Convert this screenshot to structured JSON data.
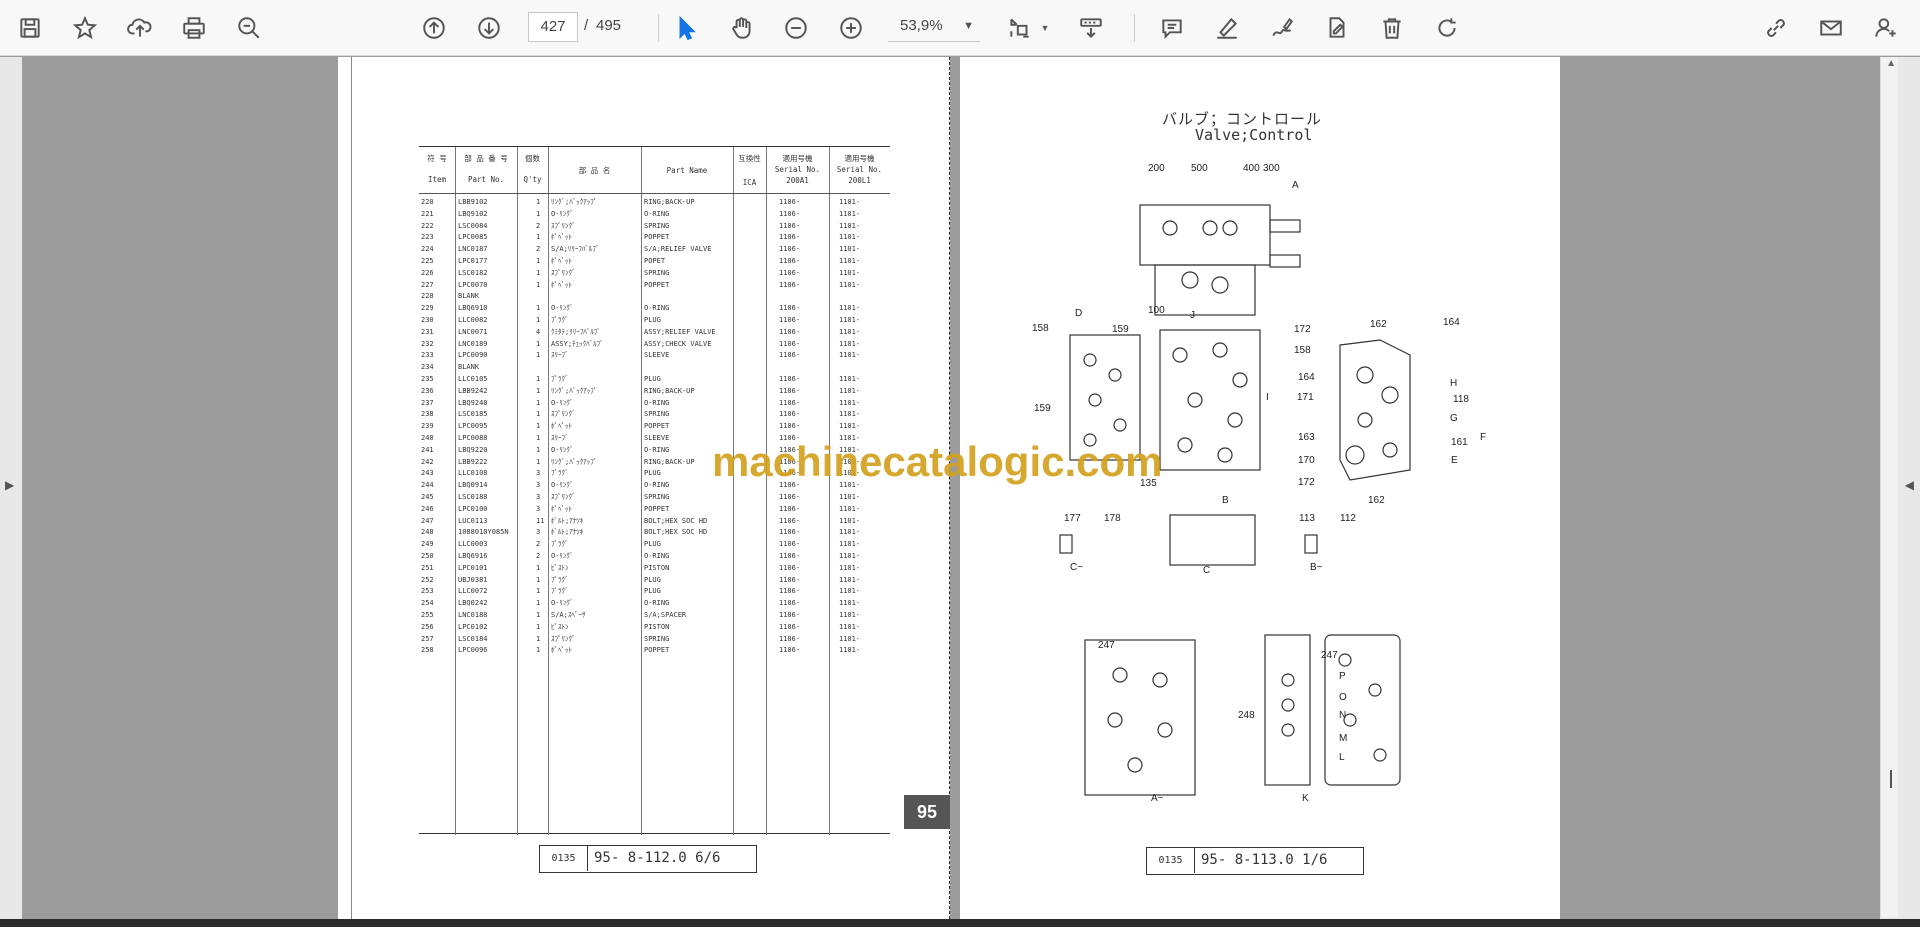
{
  "toolbar": {
    "page_current": "427",
    "page_separator": "/",
    "page_total": "495",
    "zoom_value": "53,9%",
    "icons": [
      "save-icon",
      "star-icon",
      "upload-icon",
      "print-icon",
      "zoom-search-icon",
      "page-up-icon",
      "page-down-icon",
      "select-cursor-icon",
      "hand-icon",
      "zoom-out-icon",
      "zoom-in-icon",
      "fit-page-icon",
      "scroll-mode-icon",
      "comment-icon",
      "highlight-icon",
      "sign-icon",
      "fill-sign-icon",
      "delete-icon",
      "rotate-icon",
      "share-link-icon",
      "email-icon",
      "add-user-icon"
    ]
  },
  "left_page": {
    "headers": {
      "item_jp": "符 号",
      "item_en": "Item",
      "part_no_jp": "部 品 番 号",
      "part_no_en": "Part No.",
      "qty_jp": "個数",
      "qty_en": "Q'ty",
      "name_jp": "部 品 名",
      "part_name": "Part Name",
      "ica_jp": "互換性",
      "ica": "ICA",
      "serial1_jp": "適用号機",
      "serial1_en": "Serial No.",
      "serial1_model": "200A1",
      "serial2_jp": "適用号機",
      "serial2_en": "Serial No.",
      "serial2_model": "200L1"
    },
    "rows": [
      [
        "220",
        "LBB9102",
        "1",
        "ﾘﾝｸﾞ;ﾊﾞｯｸｱｯﾌﾟ",
        "RING;BACK-UP",
        "1106-",
        "1101-"
      ],
      [
        "221",
        "LBQ9102",
        "1",
        "O-ﾘﾝｸﾞ",
        "O-RING",
        "1106-",
        "1101-"
      ],
      [
        "222",
        "LSC0084",
        "2",
        "ｽﾌﾟﾘﾝｸﾞ",
        "SPRING",
        "1106-",
        "1101-"
      ],
      [
        "223",
        "LPC0085",
        "1",
        "ﾎﾟﾍﾟｯﾄ",
        "POPPET",
        "1106-",
        "1101-"
      ],
      [
        "224",
        "LNC0187",
        "2",
        "S/A;ﾘﾘｰﾌﾊﾞﾙﾌﾞ",
        "S/A;RELIEF VALVE",
        "1106-",
        "1101-"
      ],
      [
        "225",
        "LPC0177",
        "1",
        "ﾎﾟﾍﾟｯﾄ",
        "POPET",
        "1106-",
        "1101-"
      ],
      [
        "226",
        "LSC0182",
        "1",
        "ｽﾌﾟﾘﾝｸﾞ",
        "SPRING",
        "1106-",
        "1101-"
      ],
      [
        "227",
        "LPC0070",
        "1",
        "ﾎﾟﾍﾟｯﾄ",
        "POPPET",
        "1106-",
        "1101-"
      ],
      [
        "228",
        "BLANK",
        "",
        "",
        "",
        "",
        ""
      ],
      [
        "229",
        "LBQ6910",
        "1",
        "O-ﾘﾝｸﾞ",
        "O-RING",
        "1106-",
        "1101-"
      ],
      [
        "230",
        "LLC0082",
        "1",
        "ﾌﾟﾗｸﾞ",
        "PLUG",
        "1106-",
        "1101-"
      ],
      [
        "231",
        "LNC0071",
        "4",
        "ｸﾐﾀﾃ;ﾘﾘｰﾌﾊﾞﾙﾌﾞ",
        "ASSY;RELIEF VALVE",
        "1106-",
        "1101-"
      ],
      [
        "232",
        "LNC0189",
        "1",
        "ASSY;ﾁｪｯｸﾊﾞﾙﾌﾞ",
        "ASSY;CHECK VALVE",
        "1106-",
        "1101-"
      ],
      [
        "233",
        "LPC0090",
        "1",
        "ｽﾘｰﾌﾞ",
        "SLEEVE",
        "1106-",
        "1101-"
      ],
      [
        "234",
        "BLANK",
        "",
        "",
        "",
        "",
        ""
      ],
      [
        "235",
        "LLC0105",
        "1",
        "ﾌﾟﾗｸﾞ",
        "PLUG",
        "1106-",
        "1101-"
      ],
      [
        "236",
        "LBB9242",
        "1",
        "ﾘﾝｸﾞ;ﾊﾞｯｸｱｯﾌﾟ",
        "RING;BACK-UP",
        "1106-",
        "1101-"
      ],
      [
        "237",
        "LBQ9240",
        "1",
        "O-ﾘﾝｸﾞ",
        "O-RING",
        "1106-",
        "1101-"
      ],
      [
        "238",
        "LSC0185",
        "1",
        "ｽﾌﾟﾘﾝｸﾞ",
        "SPRING",
        "1106-",
        "1101-"
      ],
      [
        "239",
        "LPC0095",
        "1",
        "ﾎﾟﾍﾟｯﾄ",
        "POPPET",
        "1106-",
        "1101-"
      ],
      [
        "240",
        "LPC0088",
        "1",
        "ｽﾘｰﾌﾞ",
        "SLEEVE",
        "1106-",
        "1101-"
      ],
      [
        "241",
        "LBQ9220",
        "1",
        "O-ﾘﾝｸﾞ",
        "O-RING",
        "1106-",
        "1101-"
      ],
      [
        "242",
        "LBB9222",
        "1",
        "ﾘﾝｸﾞ;ﾊﾞｯｸｱｯﾌﾟ",
        "RING;BACK-UP",
        "1106-",
        "1101-"
      ],
      [
        "243",
        "LLC0108",
        "3",
        "ﾌﾟﾗｸﾞ",
        "PLUG",
        "1106-",
        "1101-"
      ],
      [
        "244",
        "LBQ0914",
        "3",
        "O-ﾘﾝｸﾞ",
        "O-RING",
        "1106-",
        "1101-"
      ],
      [
        "245",
        "LSC0188",
        "3",
        "ｽﾌﾟﾘﾝｸﾞ",
        "SPRING",
        "1106-",
        "1101-"
      ],
      [
        "246",
        "LPC0100",
        "3",
        "ﾎﾟﾍﾟｯﾄ",
        "POPPET",
        "1106-",
        "1101-"
      ],
      [
        "247",
        "LUC0113",
        "11",
        "ﾎﾞﾙﾄ;ｱﾅﾂｷ",
        "BOLT;HEX SOC HD",
        "1106-",
        "1101-"
      ],
      [
        "248",
        "1088010Y085N",
        "3",
        "ﾎﾞﾙﾄ;ｱﾅﾂｷ",
        "BOLT;HEX SOC HD",
        "1106-",
        "1101-"
      ],
      [
        "249",
        "LLC0003",
        "2",
        "ﾌﾟﾗｸﾞ",
        "PLUG",
        "1106-",
        "1101-"
      ],
      [
        "250",
        "LBQ6916",
        "2",
        "O-ﾘﾝｸﾞ",
        "O-RING",
        "1106-",
        "1101-"
      ],
      [
        "251",
        "LPC0101",
        "1",
        "ﾋﾟｽﾄﾝ",
        "PISTON",
        "1106-",
        "1101-"
      ],
      [
        "252",
        "UBJ0381",
        "1",
        "ﾌﾟﾗｸﾞ",
        "PLUG",
        "1106-",
        "1101-"
      ],
      [
        "253",
        "LLC0072",
        "1",
        "ﾌﾟﾗｸﾞ",
        "PLUG",
        "1106-",
        "1101-"
      ],
      [
        "254",
        "LBQ0242",
        "1",
        "O-ﾘﾝｸﾞ",
        "O-RING",
        "1106-",
        "1101-"
      ],
      [
        "255",
        "LNC0188",
        "1",
        "S/A;ｽﾍﾟｰｻ",
        "S/A;SPACER",
        "1106-",
        "1101-"
      ],
      [
        "256",
        "LPC0102",
        "1",
        "ﾋﾟｽﾄﾝ",
        "PISTON",
        "1106-",
        "1101-"
      ],
      [
        "257",
        "LSC0184",
        "1",
        "ｽﾌﾟﾘﾝｸﾞ",
        "SPRING",
        "1106-",
        "1101-"
      ],
      [
        "258",
        "LPC0096",
        "1",
        "ﾎﾟﾍﾟｯﾄ",
        "POPPET",
        "1106-",
        "1101-"
      ]
    ],
    "footer_code": "0135",
    "footer_ref": "95- 8-112.0  6/6",
    "page_badge": "95"
  },
  "right_page": {
    "title_jp": "バルブ；コントロール",
    "title_en": "Valve;Control",
    "footer_code": "0135",
    "footer_ref": "95- 8-113.0  1/6",
    "callouts": [
      "200",
      "500",
      "400",
      "300",
      "A",
      "100",
      "J",
      "D",
      "158",
      "159",
      "172",
      "158",
      "171",
      "I",
      "159",
      "162",
      "164",
      "H",
      "118",
      "G",
      "164",
      "163",
      "161",
      "F",
      "E",
      "170",
      "172",
      "135",
      "162",
      "B",
      "177",
      "178",
      "C~",
      "C",
      "113",
      "112",
      "B~",
      "247",
      "247",
      "P",
      "O",
      "N",
      "M",
      "L",
      "248",
      "A~",
      "K"
    ]
  },
  "watermark": "machinecatalogic.com"
}
